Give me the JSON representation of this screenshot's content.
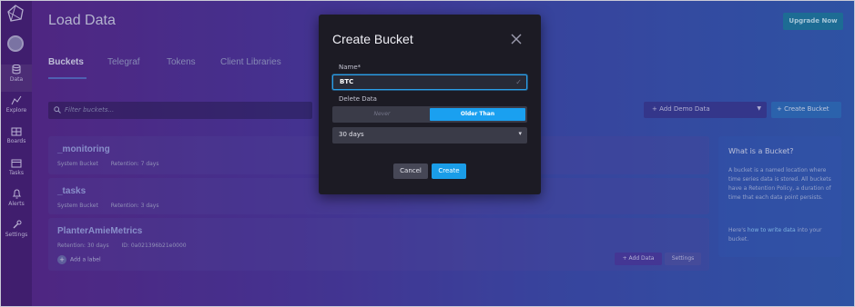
{
  "sidebar": {
    "items": [
      {
        "label": "Data",
        "icon": "database-icon",
        "active": true
      },
      {
        "label": "Explore",
        "icon": "graph-icon"
      },
      {
        "label": "Boards",
        "icon": "dashboard-icon"
      },
      {
        "label": "Tasks",
        "icon": "calendar-icon"
      },
      {
        "label": "Alerts",
        "icon": "bell-icon"
      },
      {
        "label": "Settings",
        "icon": "wrench-icon"
      }
    ]
  },
  "header": {
    "title": "Load Data",
    "upgrade_label": "Upgrade Now"
  },
  "tabs": [
    "Buckets",
    "Telegraf",
    "Tokens",
    "Client Libraries"
  ],
  "toolbar": {
    "filter_placeholder": "Filter buckets...",
    "add_demo_label": "+ Add Demo Data",
    "create_bucket_label": "+ Create Bucket"
  },
  "buckets": [
    {
      "name": "_monitoring",
      "type": "System Bucket",
      "retention": "Retention: 7 days"
    },
    {
      "name": "_tasks",
      "type": "System Bucket",
      "retention": "Retention: 3 days"
    },
    {
      "name": "PlanterAmieMetrics",
      "retention": "Retention: 30 days",
      "id": "ID: 0a021396b21e0000",
      "add_label": "Add a label",
      "add_data": "+ Add Data",
      "settings": "Settings"
    }
  ],
  "info_panel": {
    "heading": "What is a Bucket?",
    "body_1": "A bucket is a named location where time series data is stored. All buckets have a Retention Policy, a duration of time that each data point persists.",
    "body_2_pre": "Here's ",
    "body_2_link": "how to write data",
    "body_2_post": " into your bucket."
  },
  "modal": {
    "title": "Create Bucket",
    "name_label": "Name*",
    "name_value": "BTC",
    "delete_label": "Delete Data",
    "option_never": "Never",
    "option_older": "Older Than",
    "selected_option": "Older Than",
    "duration_value": "30 days",
    "cancel_label": "Cancel",
    "create_label": "Create"
  },
  "colors": {
    "accent": "#1aa0f0",
    "modal_bg": "#1c1b24"
  }
}
